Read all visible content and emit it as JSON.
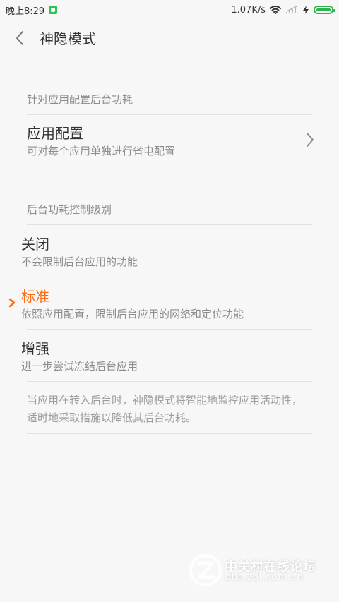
{
  "status": {
    "time": "晚上8:29",
    "speed": "1.07K/s"
  },
  "header": {
    "title": "神隐模式"
  },
  "section1": {
    "title": "针对应用配置后台功耗",
    "item": {
      "title": "应用配置",
      "subtitle": "可对每个应用单独进行省电配置"
    }
  },
  "section2": {
    "title": "后台功耗控制级别",
    "items": [
      {
        "title": "关闭",
        "subtitle": "不会限制后台应用的功能"
      },
      {
        "title": "标准",
        "subtitle": "依照应用配置，限制后台应用的网络和定位功能"
      },
      {
        "title": "增强",
        "subtitle": "进一步尝试冻结后台应用"
      }
    ]
  },
  "note": {
    "text": "当应用在转入后台时，神隐模式将智能地监控应用活动性，适时地采取措施以降低其后台功耗。"
  },
  "watermark": {
    "name": "中关村在线论坛",
    "url": "bbs.zol.com.cn"
  },
  "colors": {
    "accent": "#ff6a13",
    "battery": "#2db34a"
  }
}
